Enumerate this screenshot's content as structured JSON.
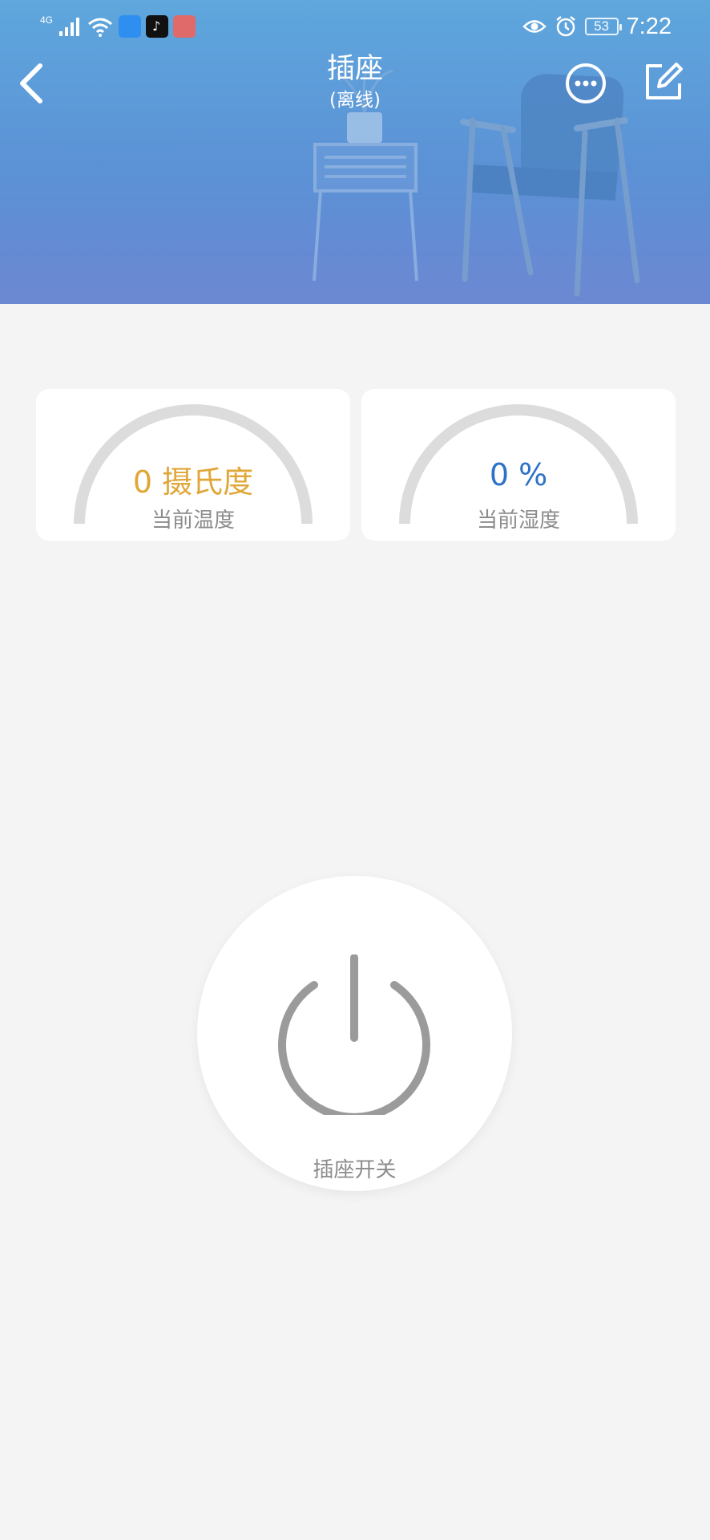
{
  "status_bar": {
    "network": "4G",
    "battery_level": "53",
    "time": "7:22",
    "icons": [
      "signal-icon",
      "wifi-icon",
      "dingtalk-app-icon",
      "tiktok-app-icon",
      "huawei-app-icon",
      "eye-icon",
      "alarm-icon",
      "battery-icon"
    ]
  },
  "nav": {
    "title": "插座",
    "subtitle": "(离线)",
    "back_icon": "chevron-left-icon",
    "more_icon": "more-circle-icon",
    "edit_icon": "edit-icon"
  },
  "cards": {
    "temperature": {
      "value": "0 摄氏度",
      "label": "当前温度",
      "color": "#e0a636"
    },
    "humidity": {
      "value": "0 %",
      "label": "当前湿度",
      "color": "#2d72c8"
    }
  },
  "power": {
    "label": "插座开关",
    "icon": "power-icon",
    "state": "off"
  },
  "colors": {
    "header_top": "#5fa7dd",
    "header_bottom": "#6a86d2",
    "background": "#f4f4f4",
    "gauge_track": "#dcdcdc",
    "power_icon": "#9b9b9b"
  }
}
